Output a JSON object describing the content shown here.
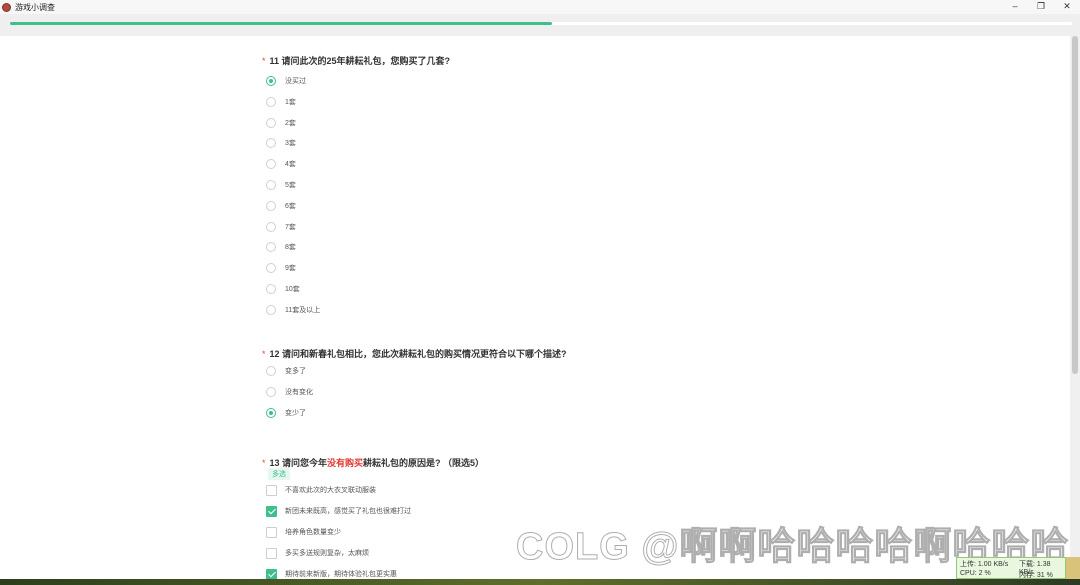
{
  "window": {
    "title": "游戏小调查",
    "controls": [
      "–",
      "❐",
      "✕"
    ]
  },
  "progress": {
    "fraction": 0.51
  },
  "q11": {
    "required": "*",
    "title": "11 请问此次的25年耕耘礼包，您购买了几套?",
    "options": [
      "没买过",
      "1套",
      "2套",
      "3套",
      "4套",
      "5套",
      "6套",
      "7套",
      "8套",
      "9套",
      "10套",
      "11套及以上"
    ],
    "selected_index": 0
  },
  "q12": {
    "required": "*",
    "title": "12 请问和新春礼包相比，您此次耕耘礼包的购买情况更符合以下哪个描述?",
    "options": [
      "变多了",
      "没有变化",
      "变少了"
    ],
    "selected_index": 2
  },
  "q13": {
    "required": "*",
    "title_before": "13 请问您今年",
    "title_highlight": "没有购买",
    "title_after": "耕耘礼包的原因是? （限选5）",
    "tag": "多选",
    "options": [
      "不喜欢此次的大衣叉联动服装",
      "新团未来既高，感觉买了礼包也很难打过",
      "培养角色数量变少",
      "多买多送规则复杂，太麻烦",
      "期待前来新版，期待体验礼包更实惠"
    ],
    "checked": [
      false,
      true,
      false,
      false,
      true
    ]
  },
  "watermark": {
    "text": "COLG @啊啊哈哈哈哈啊哈哈哈"
  },
  "net_monitor": {
    "upload": "上传: 1.00 KB/s",
    "download": "下载: 1.38 KB/s",
    "cpu": "CPU: 2 %",
    "memory": "内存: 31 %"
  },
  "colors": {
    "accent": "#3dc08c",
    "required": "#e34a3b",
    "highlight": "#e53935"
  }
}
